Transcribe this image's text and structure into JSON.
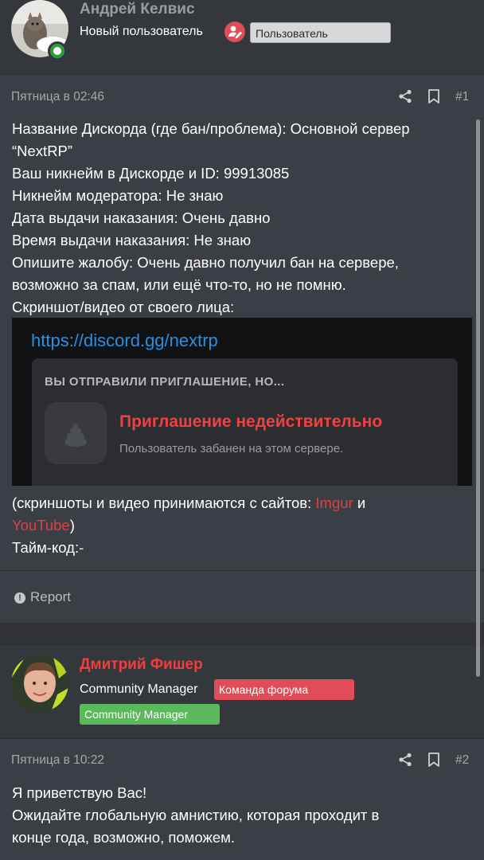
{
  "post1": {
    "author": {
      "name": "Андрей Келвис",
      "title": "Новый пользователь",
      "badge": "Пользователь",
      "online": true
    },
    "date": "Пятница в 02:46",
    "number": "#1",
    "lines": [
      "Название Дискорда (где бан/проблема): Основной сервер",
      "“NextRP”",
      "Ваш никнейм в Дискорде и ID: 99913085",
      "Никнейм модератора: Не знаю",
      "Дата выдачи наказания: Очень давно",
      "Время выдачи наказания: Не знаю",
      "Опишите жалобу: Очень давно получил бан на сервере,",
      "возможно за спам, или ещё что-то, но не помню.",
      "Скриншот/видео от своего лица:"
    ],
    "screenshot": {
      "url": "https://discord.gg/nextrp",
      "heading": "ВЫ ОТПРАВИЛИ ПРИГЛАШЕНИЕ, НО...",
      "title": "Приглашение недействительно",
      "subtitle": "Пользователь забанен на этом сервере."
    },
    "footer_text_1": "(скриншоты и видео принимаются с сайтов: ",
    "link_imgur": "Imgur",
    "footer_and": " и",
    "link_youtube": "YouTube",
    "footer_close": ")",
    "timecode": "Тайм-код:-",
    "report_label": "Report"
  },
  "post2": {
    "author": {
      "name": "Дмитрий Фишер",
      "title": "Community Manager",
      "badge_team": "Команда форума",
      "badge_cm": "Community Manager"
    },
    "date": "Пятница в 10:22",
    "number": "#2",
    "lines": [
      "Я приветствую Вас!",
      "Ожидайте глобальную амнистию, которая проходит в",
      "конце года, возможно, поможем."
    ]
  },
  "colors": {
    "background": "#3b3e44",
    "author_bg": "#34373c",
    "link_red": "#e23f45",
    "badge_team": "#e04c57",
    "badge_cm": "#5cb85c",
    "online": "#2e9d3f"
  }
}
